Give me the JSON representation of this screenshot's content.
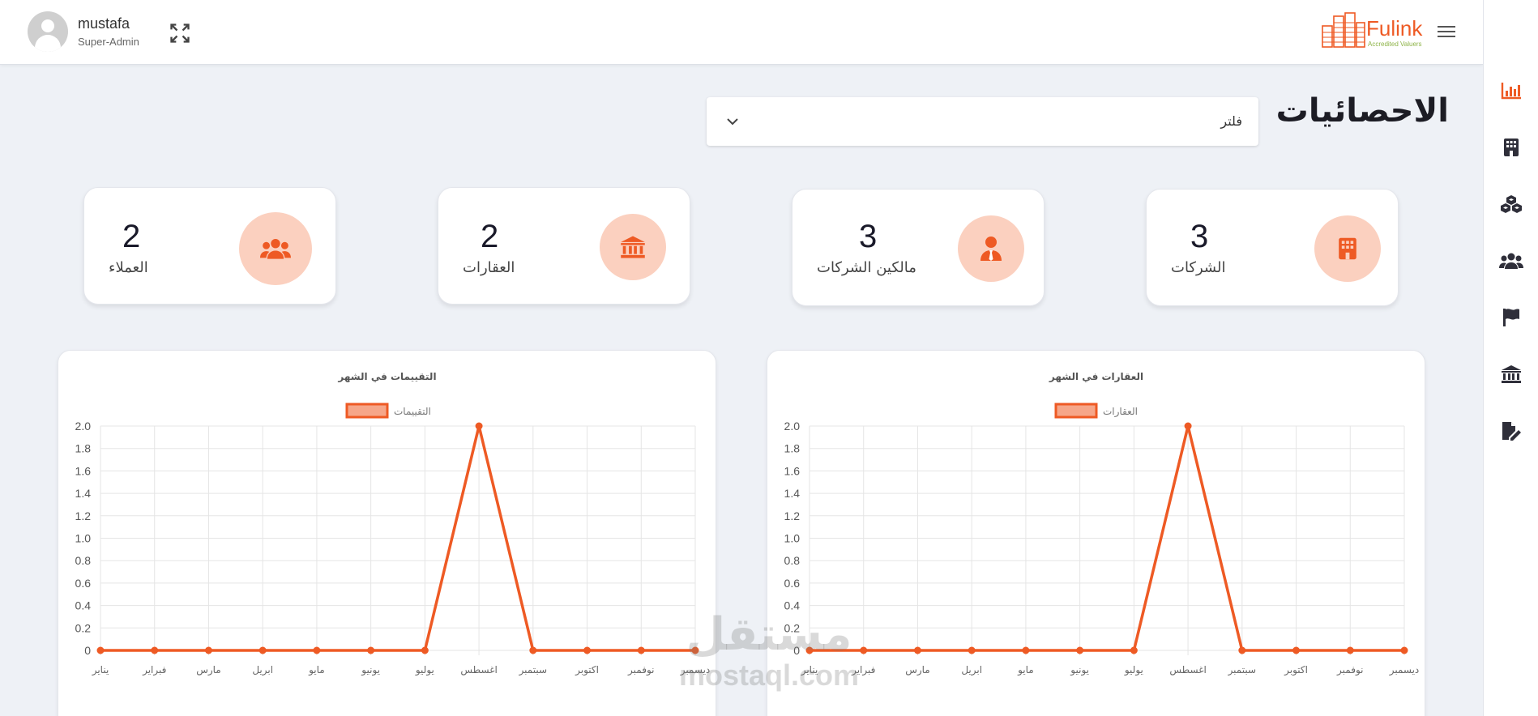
{
  "header": {
    "user_name": "mustafa",
    "user_role": "Super-Admin",
    "brand_name": "Fulink",
    "brand_tagline": "Accredited Valuers"
  },
  "sidebar": {
    "items": [
      {
        "icon": "chart-bar-icon",
        "active": true
      },
      {
        "icon": "building-icon",
        "active": false
      },
      {
        "icon": "boxes-icon",
        "active": false
      },
      {
        "icon": "users-icon",
        "active": false
      },
      {
        "icon": "flag-icon",
        "active": false
      },
      {
        "icon": "landmark-icon",
        "active": false
      },
      {
        "icon": "file-edit-icon",
        "active": false
      }
    ]
  },
  "page": {
    "title": "الاحصائيات",
    "filter_label": "فلتر"
  },
  "stats": [
    {
      "label": "الشركات",
      "value": "3",
      "icon": "building-icon"
    },
    {
      "label": "مالكين الشركات",
      "value": "3",
      "icon": "user-tie-icon"
    },
    {
      "label": "العقارات",
      "value": "2",
      "icon": "landmark-icon"
    },
    {
      "label": "العملاء",
      "value": "2",
      "icon": "users-icon"
    }
  ],
  "colors": {
    "accent": "#ee5a24",
    "icon_bg": "#fbd0bf",
    "active_icon": "#ee5a24",
    "inactive_icon": "#2f2f3a"
  },
  "chart_data": [
    {
      "type": "line",
      "title": "العقارات في الشهر",
      "categories": [
        "يناير",
        "فبراير",
        "مارس",
        "ابريل",
        "مايو",
        "يونيو",
        "يوليو",
        "اغسطس",
        "سبتمبر",
        "اكتوبر",
        "نوفمبر",
        "ديسمبر"
      ],
      "series": [
        {
          "name": "العقارات",
          "values": [
            0,
            0,
            0,
            0,
            0,
            0,
            0,
            2,
            0,
            0,
            0,
            0
          ]
        }
      ],
      "ylim": [
        0,
        2.0
      ],
      "yticks": [
        "0",
        "0.2",
        "0.4",
        "0.6",
        "0.8",
        "1.0",
        "1.2",
        "1.4",
        "1.6",
        "1.8",
        "2.0"
      ],
      "grid": true,
      "legend": "top-center"
    },
    {
      "type": "line",
      "title": "التقييمات في الشهر",
      "categories": [
        "يناير",
        "فبراير",
        "مارس",
        "ابريل",
        "مايو",
        "يونيو",
        "يوليو",
        "اغسطس",
        "سبتمبر",
        "اكتوبر",
        "نوفمبر",
        "ديسمبر"
      ],
      "series": [
        {
          "name": "التقييمات",
          "values": [
            0,
            0,
            0,
            0,
            0,
            0,
            0,
            2,
            0,
            0,
            0,
            0
          ]
        }
      ],
      "ylim": [
        0,
        2.0
      ],
      "yticks": [
        "0",
        "0.2",
        "0.4",
        "0.6",
        "0.8",
        "1.0",
        "1.2",
        "1.4",
        "1.6",
        "1.8",
        "2.0"
      ],
      "grid": true,
      "legend": "top-center"
    }
  ],
  "watermark": {
    "arabic": "مستقل",
    "latin": "mostaql.com"
  }
}
